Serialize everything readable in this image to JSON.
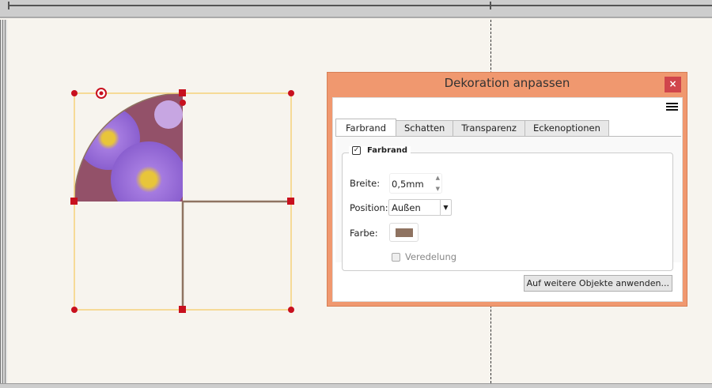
{
  "dialog": {
    "title": "Dekoration anpassen",
    "close_label": "×",
    "tabs": [
      "Farbrand",
      "Schatten",
      "Transparenz",
      "Eckenoptionen"
    ],
    "group_label": "Farbrand",
    "group_checked": true,
    "breite_label": "Breite:",
    "breite_value": "0,5mm",
    "position_label": "Position:",
    "position_value": "Außen",
    "farbe_label": "Farbe:",
    "farbe_color": "#8f7361",
    "veredelung_label": "Veredelung",
    "veredelung_checked": false,
    "apply_label": "Auf weitere Objekte anwenden..."
  },
  "colors": {
    "selection": "#f5d27a",
    "handle": "#c8101e",
    "border": "#8f7361"
  }
}
